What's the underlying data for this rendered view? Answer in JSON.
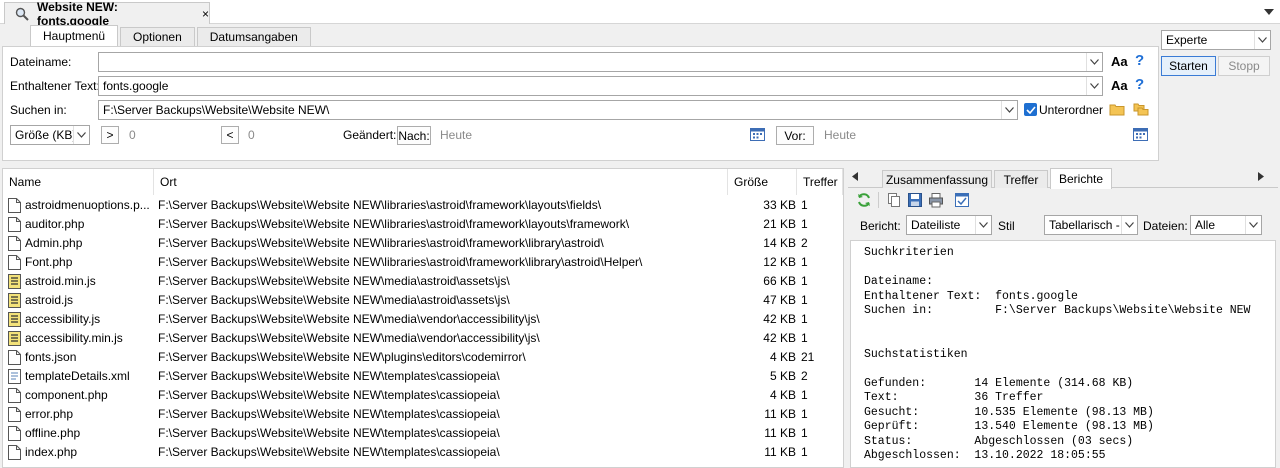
{
  "tab": {
    "title": "Website NEW: fonts.google",
    "close": "×"
  },
  "subtabs": [
    "Hauptmenü",
    "Optionen",
    "Datumsangaben"
  ],
  "form": {
    "filename_label": "Dateiname:",
    "filename_value": "",
    "text_label": "Enthaltener Text:",
    "text_value": "fonts.google",
    "searchin_label": "Suchen in:",
    "searchin_value": "F:\\Server Backups\\Website\\Website NEW\\",
    "subfolders_label": "Unterordner",
    "size_select": "Größe (KB)",
    "gt_label": ">",
    "gt_value": "0",
    "lt_label": "<",
    "lt_value": "0",
    "changed_label": "Geändert:",
    "after_label": "Nach:",
    "after_value": "Heute",
    "before_label": "Vor:",
    "before_value": "Heute",
    "case_icon_label": "Aa",
    "help_label": "?"
  },
  "right": {
    "mode": "Experte",
    "start": "Starten",
    "stop": "Stopp"
  },
  "results": {
    "headers": [
      "Name",
      "Ort",
      "Größe",
      "Treffer"
    ],
    "rows": [
      {
        "name": "astroidmenuoptions.p...",
        "path": "F:\\Server Backups\\Website\\Website NEW\\libraries\\astroid\\framework\\layouts\\fields\\",
        "size": "33 KB",
        "hits": "1",
        "type": "php"
      },
      {
        "name": "auditor.php",
        "path": "F:\\Server Backups\\Website\\Website NEW\\libraries\\astroid\\framework\\layouts\\framework\\",
        "size": "21 KB",
        "hits": "1",
        "type": "php"
      },
      {
        "name": "Admin.php",
        "path": "F:\\Server Backups\\Website\\Website NEW\\libraries\\astroid\\framework\\library\\astroid\\",
        "size": "14 KB",
        "hits": "2",
        "type": "php"
      },
      {
        "name": "Font.php",
        "path": "F:\\Server Backups\\Website\\Website NEW\\libraries\\astroid\\framework\\library\\astroid\\Helper\\",
        "size": "12 KB",
        "hits": "1",
        "type": "php"
      },
      {
        "name": "astroid.min.js",
        "path": "F:\\Server Backups\\Website\\Website NEW\\media\\astroid\\assets\\js\\",
        "size": "66 KB",
        "hits": "1",
        "type": "js"
      },
      {
        "name": "astroid.js",
        "path": "F:\\Server Backups\\Website\\Website NEW\\media\\astroid\\assets\\js\\",
        "size": "47 KB",
        "hits": "1",
        "type": "js"
      },
      {
        "name": "accessibility.js",
        "path": "F:\\Server Backups\\Website\\Website NEW\\media\\vendor\\accessibility\\js\\",
        "size": "42 KB",
        "hits": "1",
        "type": "js"
      },
      {
        "name": "accessibility.min.js",
        "path": "F:\\Server Backups\\Website\\Website NEW\\media\\vendor\\accessibility\\js\\",
        "size": "42 KB",
        "hits": "1",
        "type": "js"
      },
      {
        "name": "fonts.json",
        "path": "F:\\Server Backups\\Website\\Website NEW\\plugins\\editors\\codemirror\\",
        "size": "4 KB",
        "hits": "21",
        "type": "php"
      },
      {
        "name": "templateDetails.xml",
        "path": "F:\\Server Backups\\Website\\Website NEW\\templates\\cassiopeia\\",
        "size": "5 KB",
        "hits": "2",
        "type": "xml"
      },
      {
        "name": "component.php",
        "path": "F:\\Server Backups\\Website\\Website NEW\\templates\\cassiopeia\\",
        "size": "4 KB",
        "hits": "1",
        "type": "php"
      },
      {
        "name": "error.php",
        "path": "F:\\Server Backups\\Website\\Website NEW\\templates\\cassiopeia\\",
        "size": "11 KB",
        "hits": "1",
        "type": "php"
      },
      {
        "name": "offline.php",
        "path": "F:\\Server Backups\\Website\\Website NEW\\templates\\cassiopeia\\",
        "size": "11 KB",
        "hits": "1",
        "type": "php"
      },
      {
        "name": "index.php",
        "path": "F:\\Server Backups\\Website\\Website NEW\\templates\\cassiopeia\\",
        "size": "11 KB",
        "hits": "1",
        "type": "php"
      }
    ]
  },
  "report_panel": {
    "tabs": [
      "Zusammenfassung",
      "Treffer",
      "Berichte"
    ],
    "bericht_label": "Bericht:",
    "bericht_value": "Dateiliste",
    "stil_label": "Stil",
    "stil_value": "Tabellarisch - T",
    "dateien_label": "Dateien:",
    "dateien_value": "Alle",
    "lines": [
      "Suchkriterien",
      "",
      "Dateiname:",
      "Enthaltener Text:  fonts.google",
      "Suchen in:         F:\\Server Backups\\Website\\Website NEW",
      "",
      "",
      "Suchstatistiken",
      "",
      "Gefunden:       14 Elemente (314.68 KB)",
      "Text:           36 Treffer",
      "Gesucht:        10.535 Elemente (98.13 MB)",
      "Geprüft:        13.540 Elemente (98.13 MB)",
      "Status:         Abgeschlossen (03 secs)",
      "Abgeschlossen:  13.10.2022 18:05:55"
    ]
  }
}
